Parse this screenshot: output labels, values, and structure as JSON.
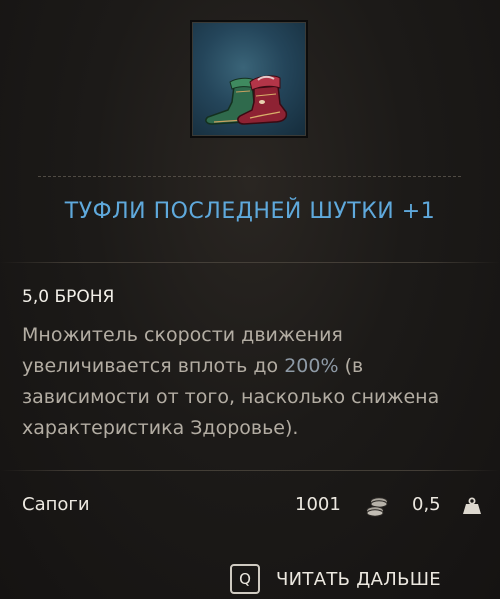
{
  "item": {
    "icon": "boots-item-icon",
    "name": "ТУФЛИ ПОСЛЕДНЕЙ ШУТКИ +1",
    "armor": "5,0 БРОНЯ",
    "description_before": "Множитель скорости движения увеличивается вплоть до ",
    "description_highlight": "200%",
    "description_after": " (в зависимости от того, насколько снижена характеристика Здоровье).",
    "type": "Сапоги",
    "value": "1001",
    "value_icon": "coin-stack-icon",
    "weight": "0,5",
    "weight_icon": "weight-icon"
  },
  "footer": {
    "key": "Q",
    "read_more_label": "ЧИТАТЬ ДАЛЬШЕ"
  },
  "colors": {
    "title": "#5fa9dc",
    "description": "#b3ada3",
    "highlight": "#8e9aa6",
    "text": "#ece8e0"
  }
}
